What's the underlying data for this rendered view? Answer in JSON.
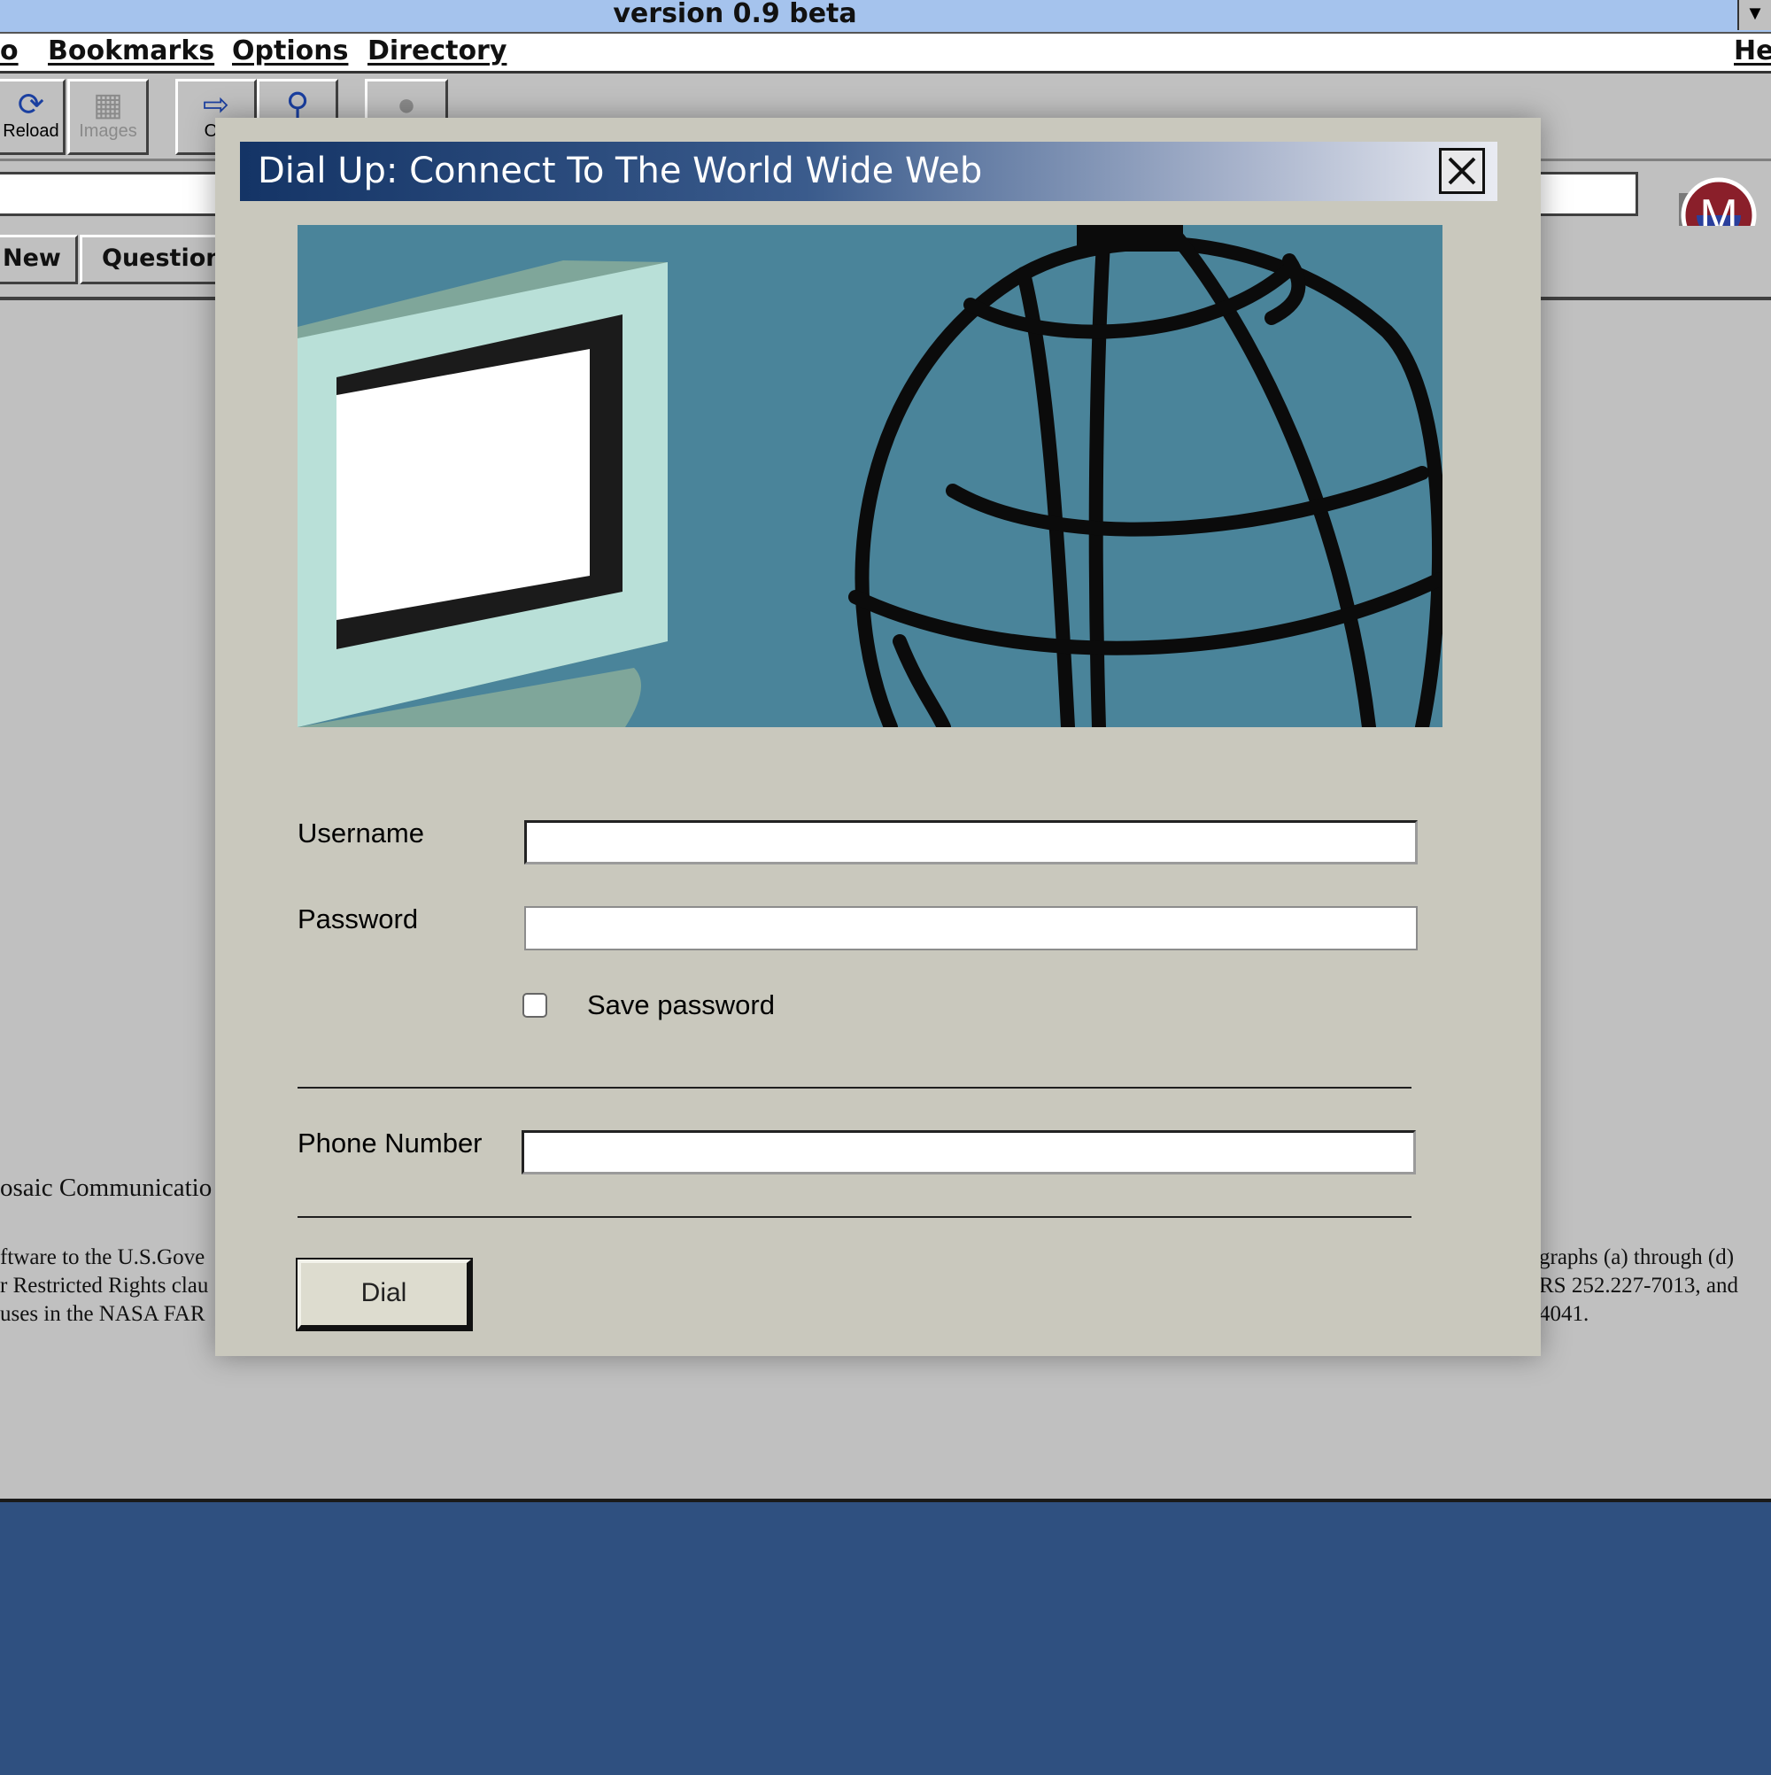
{
  "window": {
    "title": "version 0.9 beta",
    "menu": [
      "o",
      "Bookmarks",
      "Options",
      "Directory",
      "He"
    ]
  },
  "toolbar": {
    "reload": "Reload",
    "images": "Images",
    "open": "Op"
  },
  "directory_buttons": {
    "new": "New",
    "questions": "Questions"
  },
  "background_text": {
    "left_line1": "osaic Communicatio",
    "left_line2": "ftware to the U.S.Gove",
    "left_line3": "r Restricted Rights clau",
    "left_line4": "uses in the NASA FAR",
    "right_line1": "graphs (a) through (d)",
    "right_line2": "RS 252.227-7013, and",
    "right_line3": "4041."
  },
  "dialog": {
    "title": "Dial Up: Connect To The World Wide Web",
    "username_label": "Username",
    "username_value": "",
    "password_label": "Password",
    "password_value": "",
    "save_password_label": "Save password",
    "save_password_checked": false,
    "phone_label": "Phone Number",
    "phone_value": "",
    "dial_button": "Dial"
  },
  "icons": {
    "close": "close-icon",
    "reload": "reload-icon",
    "images": "images-icon",
    "open": "open-icon",
    "find": "binoculars-icon",
    "stop": "stop-icon",
    "logo": "mosaic-logo-icon"
  },
  "colors": {
    "dialog_bg": "#c9c8bd",
    "dialog_title_start": "#143466",
    "banner_bg": "#4a849a",
    "desktop": "#2f5080",
    "titlebar": "#a5c3ed"
  }
}
